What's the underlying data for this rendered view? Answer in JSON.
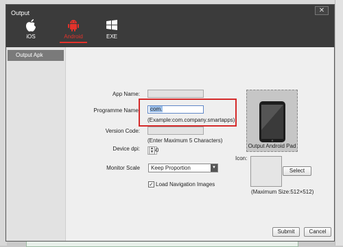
{
  "window": {
    "title": "Output",
    "close_glyph": "✕"
  },
  "platform_tabs": [
    {
      "label": "iOS",
      "icon": "apple-icon",
      "active": false
    },
    {
      "label": "Android",
      "icon": "android-icon",
      "active": true
    },
    {
      "label": "EXE",
      "icon": "windows-icon",
      "active": false
    }
  ],
  "sidebar": {
    "items": [
      {
        "label": "Output Apk"
      }
    ]
  },
  "form": {
    "app_name": {
      "label": "App Name:",
      "value": ""
    },
    "programme_name": {
      "label": "Programme Name:",
      "value": "com.",
      "hint": "(Example:com.company.smartapps)"
    },
    "version_code": {
      "label": "Version Code:",
      "value": "",
      "hint": "(Enter Maximum 5 Characters)"
    },
    "device_dpi": {
      "label": "Device dpi:",
      "value": "160"
    },
    "monitor_scale": {
      "label": "Monitor Scale",
      "value": "Keep Proportion"
    },
    "load_nav": {
      "label": "Load Navigation Images",
      "checked": true
    }
  },
  "preview": {
    "device_label": "Output Android Pad"
  },
  "icon_panel": {
    "label": "Icon:",
    "select_label": "Select",
    "max_size": "(Maximum Size:512×512)"
  },
  "footer": {
    "submit_label": "Submit",
    "cancel_label": "Cancel"
  },
  "colors": {
    "accent": "#e5322b",
    "titlebar": "#3b3b3b"
  }
}
